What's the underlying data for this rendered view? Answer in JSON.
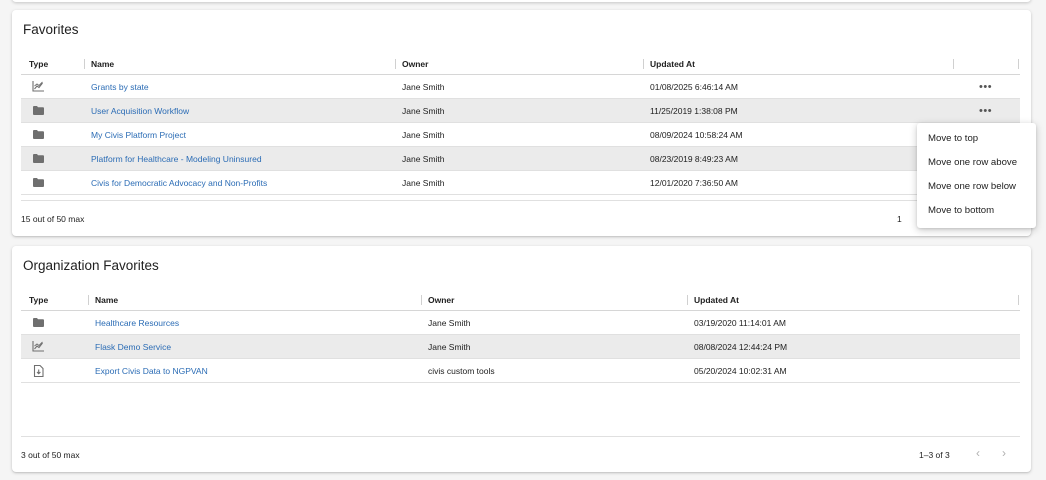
{
  "favorites": {
    "title": "Favorites",
    "columns": {
      "type": "Type",
      "name": "Name",
      "owner": "Owner",
      "updated": "Updated At"
    },
    "rows": [
      {
        "icon": "chart-icon",
        "name": "Grants by state",
        "owner": "Jane Smith",
        "updated": "01/08/2025 6:46:14 AM",
        "more": "•••"
      },
      {
        "icon": "folder-icon",
        "name": "User Acquisition Workflow",
        "owner": "Jane Smith",
        "updated": "11/25/2019 1:38:08 PM",
        "more": "•••"
      },
      {
        "icon": "folder-icon",
        "name": "My Civis Platform Project",
        "owner": "Jane Smith",
        "updated": "08/09/2024 10:58:24 AM"
      },
      {
        "icon": "folder-icon",
        "name": "Platform for Healthcare - Modeling Uninsured",
        "owner": "Jane Smith",
        "updated": "08/23/2019 8:49:23 AM"
      },
      {
        "icon": "folder-icon",
        "name": "Civis for Democratic Advocacy and Non-Profits",
        "owner": "Jane Smith",
        "updated": "12/01/2020 7:36:50 AM"
      }
    ],
    "footer_count": "15 out of 50 max",
    "footer_range_partial": "1"
  },
  "context_menu": {
    "items": [
      "Move to top",
      "Move one row above",
      "Move one row below",
      "Move to bottom"
    ]
  },
  "org_favorites": {
    "title": "Organization Favorites",
    "columns": {
      "type": "Type",
      "name": "Name",
      "owner": "Owner",
      "updated": "Updated At"
    },
    "rows": [
      {
        "icon": "folder-icon",
        "name": "Healthcare Resources",
        "owner": "Jane Smith",
        "updated": "03/19/2020 11:14:01 AM"
      },
      {
        "icon": "chart-icon",
        "name": "Flask Demo Service",
        "owner": "Jane Smith",
        "updated": "08/08/2024 12:44:24 PM"
      },
      {
        "icon": "import-icon",
        "name": "Export Civis Data to NGPVAN",
        "owner": "civis custom tools",
        "updated": "05/20/2024 10:02:31 AM"
      }
    ],
    "footer_count": "3 out of 50 max",
    "footer_range": "1–3 of 3",
    "prev": "‹",
    "next": "›"
  },
  "colors": {
    "link": "#2b6cb5",
    "row_highlight": "#ebebeb",
    "icon": "#6f6f6f"
  }
}
